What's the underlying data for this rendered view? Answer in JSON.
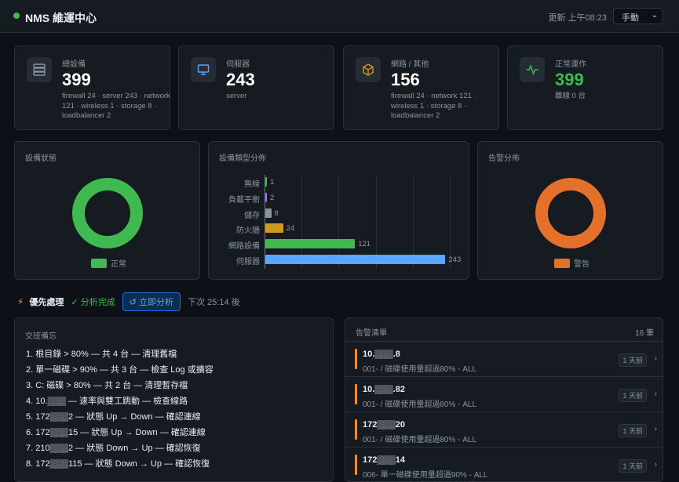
{
  "header": {
    "title": "NMS 維運中心",
    "updated": "更新 上午08:23",
    "mode": "手動"
  },
  "stats": [
    {
      "label": "總設備",
      "value": "399",
      "sub": "firewall 24 · server 243 · network 121 · wireless 1 · storage 8 · loadbalancer 2",
      "icon": "server-stack-icon"
    },
    {
      "label": "伺服器",
      "value": "243",
      "sub": "server",
      "icon": "monitor-icon"
    },
    {
      "label": "網路 / 其他",
      "value": "156",
      "sub": "firewall 24 · network 121 · wireless 1 · storage 8 · loadbalancer 2",
      "icon": "cube-icon"
    },
    {
      "label": "正常運作",
      "value": "399",
      "sub": "離線 0 台",
      "icon": "activity-icon"
    }
  ],
  "status_chart": {
    "title": "設備狀態",
    "legend": "正常",
    "color": "#3fb950"
  },
  "type_chart": {
    "title": "設備類型分佈"
  },
  "alert_chart": {
    "title": "告警分佈",
    "legend": "警告",
    "color": "#e3712b"
  },
  "chart_data": [
    {
      "type": "pie",
      "title": "設備狀態",
      "categories": [
        "正常"
      ],
      "values": [
        399
      ],
      "colors": [
        "#3fb950"
      ]
    },
    {
      "type": "bar",
      "orientation": "horizontal",
      "title": "設備類型分佈",
      "categories": [
        "無線",
        "負載平衡",
        "儲存",
        "防火牆",
        "網路設備",
        "伺服器"
      ],
      "values": [
        1,
        2,
        8,
        24,
        121,
        243
      ],
      "colors": [
        "#3fb950",
        "#a371f7",
        "#8b949e",
        "#d29922",
        "#3fb950",
        "#58a6ff"
      ],
      "xlim": [
        0,
        250
      ],
      "grid": true
    },
    {
      "type": "pie",
      "title": "告警分佈",
      "categories": [
        "警告"
      ],
      "values": [
        16
      ],
      "colors": [
        "#e3712b"
      ]
    }
  ],
  "priority": {
    "title": "優先處理",
    "done": "✓ 分析完成",
    "button": "↺ 立即分析",
    "next": "下次 25:14 後"
  },
  "memo": {
    "title": "交班備忘",
    "items": [
      "1. 根目錄 > 80% — 共 4 台 — 清理舊檔",
      "2. 單一磁碟 > 90% — 共 3 台 — 檢查 Log 或擴容",
      "3. C: 磁碟 > 80% — 共 2 台 — 清理暫存檔",
      "4. 10.▒▒▒ — 速率與雙工跳動 — 檢查線路",
      "5. 172▒▒▒2 — 狀態 Up → Down — 確認連線",
      "6. 172▒▒▒15 — 狀態 Up → Down — 確認連線",
      "7. 210▒▒▒2 — 狀態 Down → Up — 確認恢復",
      "8. 172▒▒▒115 — 狀態 Down → Up — 確認恢復"
    ]
  },
  "alerts": {
    "title": "告警清單",
    "count": "16 筆",
    "items": [
      {
        "ip": "10.▒▒▒.8",
        "desc": "001- / 磁碟使用量超過80% - ALL",
        "time": "1 天前"
      },
      {
        "ip": "10.▒▒▒.82",
        "desc": "001- / 磁碟使用量超過80% - ALL",
        "time": "1 天前"
      },
      {
        "ip": "172▒▒▒20",
        "desc": "001- / 磁碟使用量超過80% - ALL",
        "time": "1 天前"
      },
      {
        "ip": "172▒▒▒14",
        "desc": "006- 單一磁碟使用量超過90% - ALL",
        "time": "1 天前"
      }
    ]
  }
}
